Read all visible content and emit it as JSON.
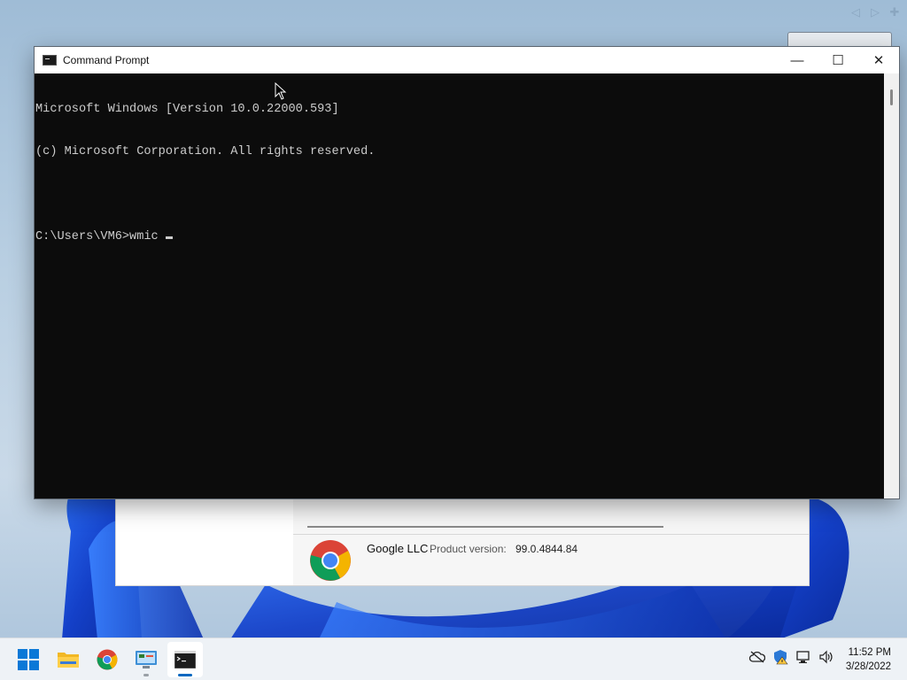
{
  "window": {
    "title": "Command Prompt",
    "controls": {
      "minimize": "—",
      "maximize": "☐",
      "close": "✕"
    }
  },
  "console": {
    "lines": [
      "Microsoft Windows [Version 10.0.22000.593]",
      "(c) Microsoft Corporation. All rights reserved.",
      "",
      "C:\\Users\\VM6>wmic "
    ]
  },
  "background_window": {
    "publisher": "Google LLC",
    "product_version_label": "Product version:",
    "product_version_value": "99.0.4844.84",
    "icon": "chrome-icon"
  },
  "taskbar": {
    "apps": [
      {
        "name": "start-button",
        "icon": "windows-logo-icon",
        "active": false
      },
      {
        "name": "file-explorer",
        "icon": "folder-icon",
        "active": false
      },
      {
        "name": "chrome",
        "icon": "chrome-icon",
        "active": false
      },
      {
        "name": "control-panel",
        "icon": "control-panel-icon",
        "active": false,
        "running": true
      },
      {
        "name": "command-prompt",
        "icon": "cmd-icon",
        "active": true,
        "running": true
      }
    ],
    "tray": [
      "cloud-off-icon",
      "security-warning-icon",
      "network-icon",
      "volume-icon"
    ],
    "time": "11:52 PM",
    "date": "3/28/2022"
  },
  "remote_bar": {
    "icons": [
      "left-arrow-icon",
      "right-arrow-icon",
      "plus-icon"
    ]
  },
  "colors": {
    "console_bg": "#0c0c0c",
    "console_fg": "#cccccc",
    "accent": "#0067c0",
    "wallpaper_blue": "#1b4fd8"
  }
}
